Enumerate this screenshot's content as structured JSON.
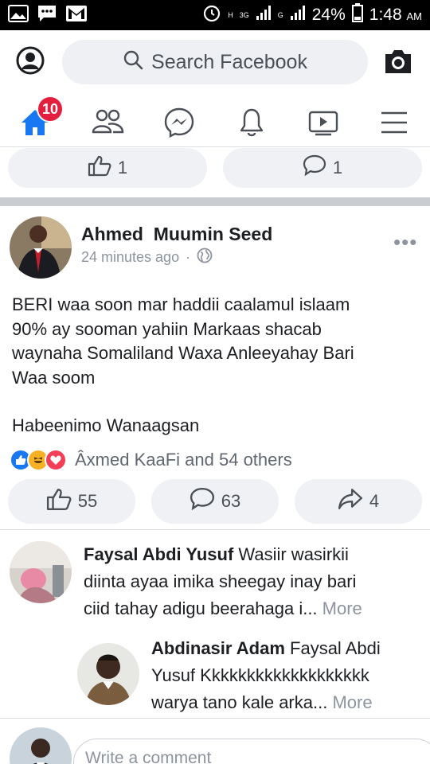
{
  "status_bar": {
    "network_1": "H",
    "network_2": "3G",
    "network_3": "G",
    "battery": "24%",
    "time": "1:48",
    "ampm": "AM"
  },
  "search": {
    "placeholder": "Search Facebook"
  },
  "nav": {
    "home_badge": "10"
  },
  "prev_post": {
    "likes": "1",
    "comments": "1"
  },
  "post": {
    "author": "Ahmed  Muumin Seed",
    "time": "24 minutes ago",
    "separator": "·",
    "body_lines": [
      "BERI waa soon mar haddii caalamul islaam",
      "90% ay sooman yahiin Markaas shacab",
      "waynaha Somaliland Waxa Anleeyahay Bari",
      "Waa soom"
    ],
    "body_line_last": "Habeenimo Wanaagsan",
    "reactions_text": "Âxmed KaaFi and 54 others",
    "likes": "55",
    "comments": "63",
    "shares": "4"
  },
  "comments": [
    {
      "name": "Faysal Abdi Yusuf",
      "line1": "Wasiir wasirkii",
      "line2": "diinta ayaa imika sheegay inay bari",
      "line3": "ciid tahay adigu beerahaga i...",
      "more": "More"
    },
    {
      "name": "Abdinasir Adam",
      "line1": "Faysal Abdi",
      "line2": "Yusuf Kkkkkkkkkkkkkkkkkkk",
      "line3": "warya tano kale arka...",
      "more": "More"
    }
  ],
  "write_comment": {
    "placeholder": "Write a comment"
  },
  "colors": {
    "facebook_blue": "#1877f2",
    "badge_red": "#e41e3f",
    "search_bg": "#eef0f3",
    "pill_bg": "#eff1f4"
  }
}
